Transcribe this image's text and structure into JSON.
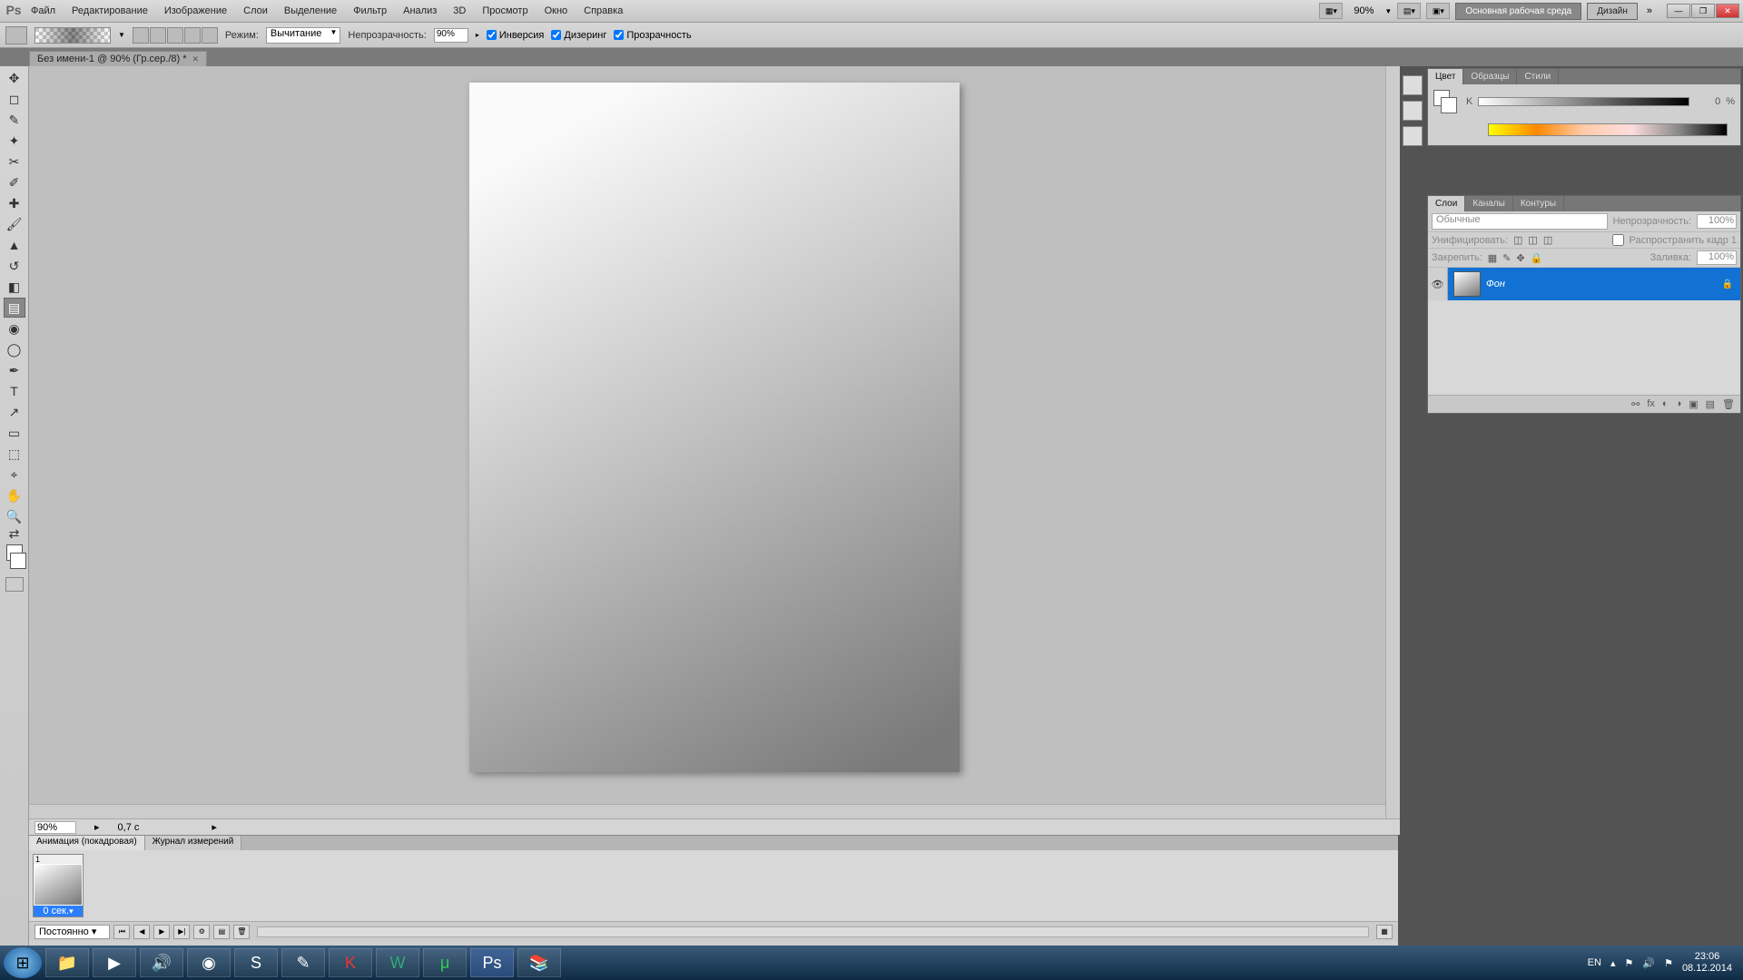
{
  "menubar": {
    "items": [
      "Файл",
      "Редактирование",
      "Изображение",
      "Слои",
      "Выделение",
      "Фильтр",
      "Анализ",
      "3D",
      "Просмотр",
      "Окно",
      "Справка"
    ],
    "zoom": "90%",
    "workspace_main": "Основная рабочая среда",
    "workspace_alt": "Дизайн"
  },
  "options": {
    "mode_label": "Режим:",
    "mode_value": "Вычитание",
    "opacity_label": "Непрозрачность:",
    "opacity_value": "90%",
    "checks": [
      "Инверсия",
      "Дизеринг",
      "Прозрачность"
    ]
  },
  "doc_tab": "Без имени-1 @ 90% (Гр.сер./8) *",
  "status": {
    "zoom": "90%",
    "doc": "0,7 c"
  },
  "color_panel": {
    "tabs": [
      "Цвет",
      "Образцы",
      "Стили"
    ],
    "channel": "K",
    "value": "0",
    "unit": "%"
  },
  "layers_panel": {
    "tabs": [
      "Слои",
      "Каналы",
      "Контуры"
    ],
    "blend_label": "Обычные",
    "opacity_label": "Непрозрачность:",
    "opacity_value": "100%",
    "unify_label": "Унифицировать:",
    "propagate_label": "Распространить кадр 1",
    "lock_label": "Закрепить:",
    "fill_label": "Заливка:",
    "fill_value": "100%",
    "layer_name": "Фон"
  },
  "animation": {
    "tabs": [
      "Анимация (покадровая)",
      "Журнал измерений"
    ],
    "frame_num": "1",
    "frame_time": "0 сек.",
    "loop": "Постоянно"
  },
  "taskbar": {
    "lang": "EN",
    "time": "23:06",
    "date": "08.12.2014"
  }
}
